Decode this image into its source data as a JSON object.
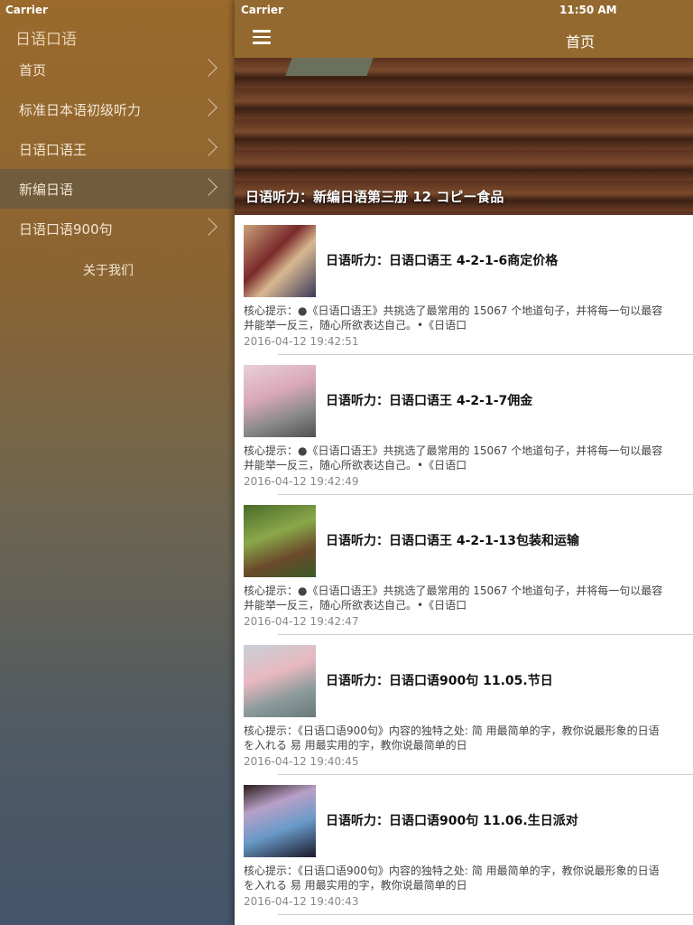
{
  "sidebar": {
    "carrier": "Carrier",
    "title": "日语口语",
    "items": [
      {
        "label": "首页"
      },
      {
        "label": "标准日本语初级听力"
      },
      {
        "label": "日语口语王"
      },
      {
        "label": "新编日语"
      },
      {
        "label": "日语口语900句"
      }
    ],
    "about": "关于我们"
  },
  "status": {
    "carrier": "Carrier",
    "time": "11:50 AM"
  },
  "nav": {
    "title": "首页"
  },
  "banner": {
    "caption": "日语听力：新编日语第三册 12 コピー食品"
  },
  "articles": [
    {
      "title": "日语听力：日语口语王 4-2-1-6商定价格",
      "line1": "核心提示：●《日语口语王》共挑选了最常用的 15067 个地道句子，并将每一句以最容",
      "line2": "并能举一反三，随心所欲表达自己。•《日语口",
      "date": "2016-04-12 19:42:51"
    },
    {
      "title": "日语听力：日语口语王 4-2-1-7佣金",
      "line1": "核心提示：●《日语口语王》共挑选了最常用的 15067 个地道句子，并将每一句以最容",
      "line2": "并能举一反三，随心所欲表达自己。•《日语口",
      "date": "2016-04-12 19:42:49"
    },
    {
      "title": "日语听力：日语口语王 4-2-1-13包装和运输",
      "line1": "核心提示：●《日语口语王》共挑选了最常用的 15067 个地道句子，并将每一句以最容",
      "line2": "并能举一反三，随心所欲表达自己。•《日语口",
      "date": "2016-04-12 19:42:47"
    },
    {
      "title": "日语听力：日语口语900句 11.05.节日",
      "line1": "核心提示：《日语口语900句》内容的独特之处: 简 用最简单的字，教你说最形象的日语",
      "line2": "を入れる 易 用最实用的字，教你说最简单的日",
      "date": "2016-04-12 19:40:45"
    },
    {
      "title": "日语听力：日语口语900句 11.06.生日派对",
      "line1": "核心提示：《日语口语900句》内容的独特之处: 简 用最简单的字，教你说最形象的日语",
      "line2": "を入れる 易 用最实用的字，教你说最简单的日",
      "date": "2016-04-12 19:40:43"
    }
  ]
}
